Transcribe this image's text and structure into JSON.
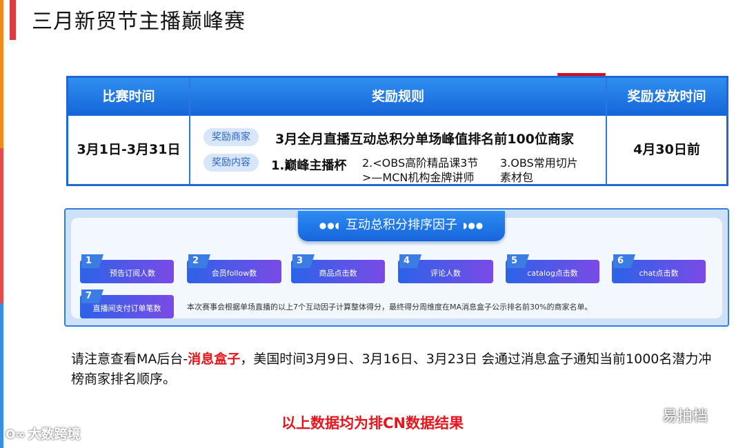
{
  "page": {
    "title": "三月新贸节主播巅峰赛"
  },
  "reward_table": {
    "headers": [
      "比赛时间",
      "奖励规则",
      "奖励发放时间"
    ],
    "period": "3月1日-3月31日",
    "merchant_tag": "奖励商家",
    "merchant_rule": "3月全月直播互动总积分单场峰值排名前100位商家",
    "content_tag": "奖励内容",
    "reward_1": "1.巅峰主播杯",
    "reward_2_line1": "2.<OBS高阶精品课3节",
    "reward_2_line2": ">—MCN机构金牌讲师",
    "reward_3_line1": "3.OBS常用切片",
    "reward_3_line2": "素材包",
    "payout": "4月30日前"
  },
  "factors": {
    "heading": "互动总积分排序因子",
    "items": [
      {
        "num": "1",
        "label": "预告订阅人数"
      },
      {
        "num": "2",
        "label": "会员follow数"
      },
      {
        "num": "3",
        "label": "商品点击数"
      },
      {
        "num": "4",
        "label": "评论人数"
      },
      {
        "num": "5",
        "label": "catalog点击数"
      },
      {
        "num": "6",
        "label": "chat点击数"
      },
      {
        "num": "7",
        "label": "直播间支付订单笔数"
      }
    ],
    "note": "本次赛事会根据单场直播的以上7个互动因子计算整体得分，最终得分周维度在MA消息盒子公示排名前30%的商家名单。"
  },
  "notice": {
    "prefix": "请注意查看MA后台-",
    "highlight": "消息盒子",
    "suffix": "，美国时间3月9日、3月16日、3月23日 会通过消息盒子通知当前1000名潜力冲榜商家排名顺序。"
  },
  "result_note": "以上数据均为排CN数据结果",
  "watermarks": {
    "left": "大数跨境",
    "right": "易拍档"
  },
  "colors": {
    "accent_blue": "#1f67d2",
    "highlight_red": "#e8141c",
    "title_bar": "#e03a3a"
  }
}
